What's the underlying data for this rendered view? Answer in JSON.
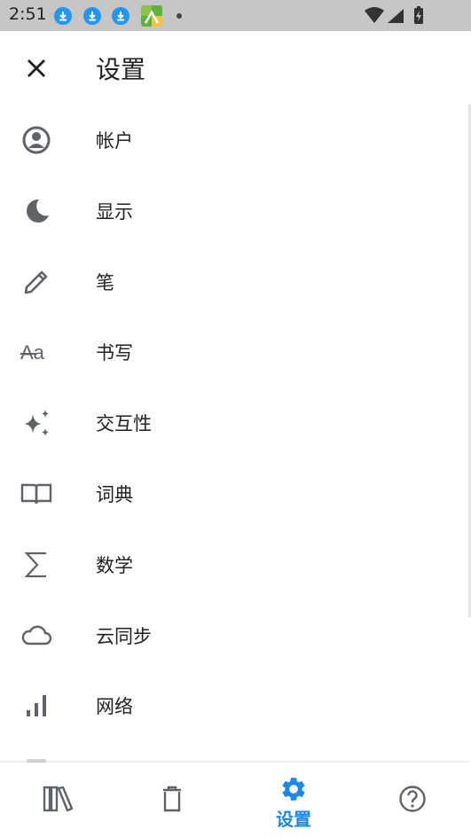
{
  "status_bar": {
    "time": "2:51"
  },
  "header": {
    "title": "设置"
  },
  "menu": {
    "items": [
      {
        "icon": "account-circle-icon",
        "label": "帐户"
      },
      {
        "icon": "moon-icon",
        "label": "显示"
      },
      {
        "icon": "pencil-icon",
        "label": "笔"
      },
      {
        "icon": "text-style-icon",
        "label": "书写"
      },
      {
        "icon": "sparkle-icon",
        "label": "交互性"
      },
      {
        "icon": "book-icon",
        "label": "词典"
      },
      {
        "icon": "sigma-icon",
        "label": "数学"
      },
      {
        "icon": "cloud-icon",
        "label": "云同步"
      },
      {
        "icon": "signal-bars-icon",
        "label": "网络"
      }
    ]
  },
  "text_style_glyph": "Aa",
  "bottom_nav": {
    "items": [
      {
        "icon": "library-icon",
        "label": ""
      },
      {
        "icon": "trash-icon",
        "label": ""
      },
      {
        "icon": "gear-icon",
        "label": "设置",
        "active": true
      },
      {
        "icon": "help-icon",
        "label": ""
      }
    ]
  },
  "colors": {
    "accent": "#1e88e5",
    "status_bar": "#c6c6c6",
    "icon": "#5f6368",
    "text": "#202124"
  }
}
